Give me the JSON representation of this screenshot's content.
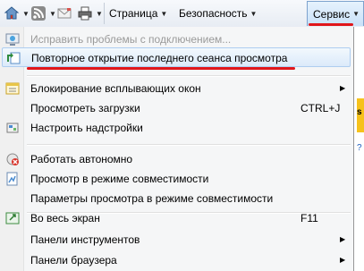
{
  "toolbar": {
    "page_label": "Страница",
    "safety_label": "Безопасность",
    "tools_label": "Сервис"
  },
  "page_strip": {
    "text1": "s",
    "text2": "?"
  },
  "menu": {
    "items": [
      {
        "label": "Исправить проблемы с подключением...",
        "shortcut": "",
        "icon": "network-diagnose-icon"
      },
      {
        "label": "Повторное открытие последнего сеанса просмотра",
        "shortcut": "",
        "icon": "reopen-session-icon"
      },
      {
        "label": "Блокирование всплывающих окон",
        "shortcut": "",
        "icon": "popup-blocker-icon"
      },
      {
        "label": "Просмотреть загрузки",
        "shortcut": "CTRL+J",
        "icon": ""
      },
      {
        "label": "Настроить надстройки",
        "shortcut": "",
        "icon": "addons-icon"
      },
      {
        "label": "Работать автономно",
        "shortcut": "",
        "icon": "offline-icon"
      },
      {
        "label": "Просмотр в режиме совместимости",
        "shortcut": "",
        "icon": "compat-view-icon"
      },
      {
        "label": "Параметры просмотра в режиме совместимости",
        "shortcut": "",
        "icon": ""
      },
      {
        "label": "Во весь экран",
        "shortcut": "F11",
        "icon": "fullscreen-icon"
      },
      {
        "label": "Панели инструментов",
        "shortcut": "",
        "icon": ""
      },
      {
        "label": "Панели браузера",
        "shortcut": "",
        "icon": ""
      }
    ]
  },
  "colors": {
    "highlight": "#dbeafa",
    "annotation_red": "#e0161b"
  }
}
